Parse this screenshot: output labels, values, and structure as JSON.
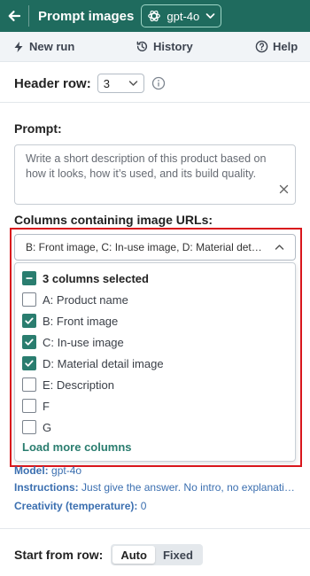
{
  "header": {
    "title": "Prompt images",
    "model_label": "gpt-4o"
  },
  "toolbar": {
    "new_run": "New run",
    "history": "History",
    "help": "Help"
  },
  "header_row": {
    "label": "Header row:",
    "value": "3"
  },
  "prompt": {
    "label": "Prompt:",
    "text": "Write a short description of this product based on how it looks, how it’s used, and its build quality."
  },
  "columns": {
    "label": "Columns containing image URLs:",
    "selected_value": "B: Front image, C: In-use image, D: Material detail image",
    "summary": "3 columns selected",
    "options": [
      {
        "label": "A: Product name",
        "checked": false
      },
      {
        "label": "B: Front image",
        "checked": true
      },
      {
        "label": "C: In-use image",
        "checked": true
      },
      {
        "label": "D: Material detail image",
        "checked": true
      },
      {
        "label": "E: Description",
        "checked": false
      },
      {
        "label": "F",
        "checked": false
      },
      {
        "label": "G",
        "checked": false
      }
    ],
    "load_more": "Load more columns"
  },
  "settings": {
    "model_label": "Model:",
    "model_value": "gpt-4o",
    "instructions_label": "Instructions:",
    "instructions_value": "Just give the answer. No intro, no explanation.",
    "creativity_label": "Creativity (temperature):",
    "creativity_value": "0"
  },
  "start_row": {
    "label": "Start from row:",
    "options": [
      "Auto",
      "Fixed"
    ],
    "selected": "Auto"
  },
  "colors": {
    "brand": "#1f6b5e",
    "accent": "#2a7d6f",
    "highlight": "#d9161c",
    "link": "#3b6fb0"
  }
}
